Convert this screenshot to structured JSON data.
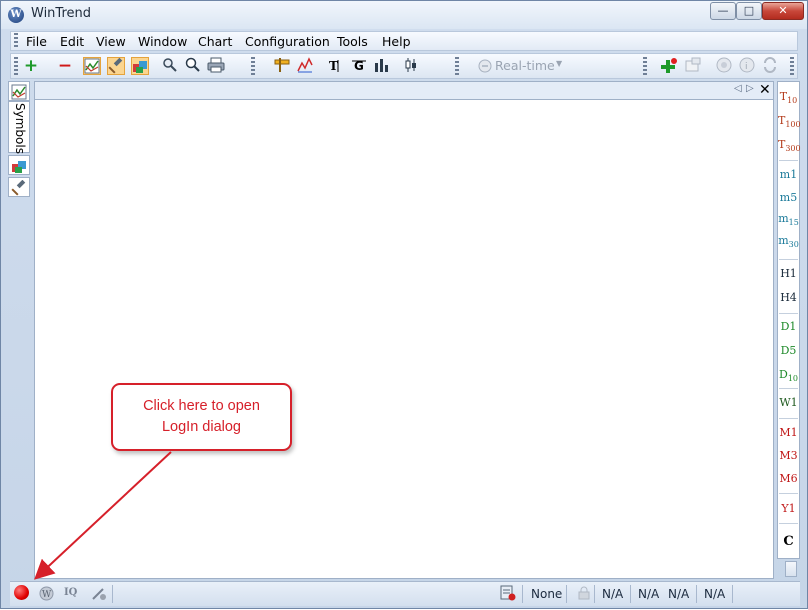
{
  "window": {
    "title": "WinTrend",
    "app_icon": "W",
    "controls": {
      "minimize": "—",
      "maximize": "□",
      "close": "✕"
    }
  },
  "menu": {
    "items": [
      {
        "label": "File",
        "mnemonic": "F"
      },
      {
        "label": "Edit",
        "mnemonic": "E"
      },
      {
        "label": "View",
        "mnemonic": "V"
      },
      {
        "label": "Window",
        "mnemonic": "W"
      },
      {
        "label": "Chart",
        "mnemonic": "C"
      },
      {
        "label": "Configuration",
        "mnemonic": "o"
      },
      {
        "label": "Tools",
        "mnemonic": ""
      },
      {
        "label": "Help",
        "mnemonic": "H"
      }
    ]
  },
  "toolbar": {
    "add_icon": "+",
    "remove_icon": "−",
    "realtime_label": "Real-time",
    "grip_symbol": "⋮"
  },
  "left_dock": {
    "symbols_label": "Symbols"
  },
  "tabstrip": {
    "prev": "◁",
    "next": "▷",
    "close": "✕"
  },
  "timeframes": [
    {
      "main": "T",
      "sub": "10",
      "color": "#b33a1a"
    },
    {
      "main": "T",
      "sub": "100",
      "color": "#b33a1a"
    },
    {
      "main": "T",
      "sub": "300",
      "color": "#b33a1a"
    },
    {
      "main": "m1",
      "sub": "",
      "color": "#1b7a9a"
    },
    {
      "main": "m5",
      "sub": "",
      "color": "#1b7a9a"
    },
    {
      "main": "m",
      "sub": "15",
      "color": "#1b7a9a"
    },
    {
      "main": "m",
      "sub": "30",
      "color": "#1b7a9a"
    },
    {
      "main": "H1",
      "sub": "",
      "color": "#1a2a3a"
    },
    {
      "main": "H4",
      "sub": "",
      "color": "#1a2a3a"
    },
    {
      "main": "D1",
      "sub": "",
      "color": "#1f8a2a"
    },
    {
      "main": "D5",
      "sub": "",
      "color": "#1f8a2a"
    },
    {
      "main": "D",
      "sub": "10",
      "color": "#1f8a2a"
    },
    {
      "main": "W1",
      "sub": "",
      "color": "#1f5a1f"
    },
    {
      "main": "M1",
      "sub": "",
      "color": "#c01818"
    },
    {
      "main": "M3",
      "sub": "",
      "color": "#c01818"
    },
    {
      "main": "M6",
      "sub": "",
      "color": "#c01818"
    },
    {
      "main": "Y1",
      "sub": "",
      "color": "#c01818"
    },
    {
      "main": "C",
      "sub": "",
      "color": "#000000"
    }
  ],
  "statusbar": {
    "iq_label": "IQ",
    "none_label": "None",
    "na1": "N/A",
    "na2": "N/A",
    "na3": "N/A",
    "na4": "N/A"
  },
  "callout": {
    "line1": "Click here to open",
    "line2": "LogIn dialog"
  },
  "colors": {
    "accent_red": "#d6202a",
    "record_dot": "#e00000"
  }
}
